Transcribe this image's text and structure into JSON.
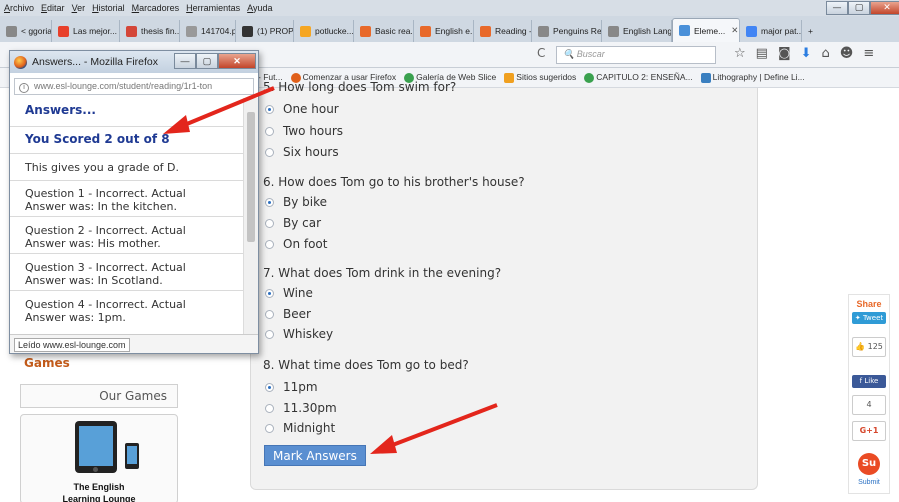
{
  "menubar": {
    "items": [
      "Archivo",
      "Editar",
      "Ver",
      "Historial",
      "Marcadores",
      "Herramientas",
      "Ayuda"
    ]
  },
  "window_controls": {
    "minimize": "—",
    "maximize": "▢",
    "close": "✕"
  },
  "tabs": [
    {
      "label": "< ggoria...",
      "icon_color": "#888888"
    },
    {
      "label": "Las mejor...",
      "icon_color": "#e8402b"
    },
    {
      "label": "thesis fin...",
      "icon_color": "#d44638"
    },
    {
      "label": "141704.pdf",
      "icon_color": "#999999"
    },
    {
      "label": "(1) PROP...",
      "icon_color": "#333333"
    },
    {
      "label": "potlucke...",
      "icon_color": "#f5a623"
    },
    {
      "label": "Basic rea...",
      "icon_color": "#e8692a"
    },
    {
      "label": "English e...",
      "icon_color": "#e8692a"
    },
    {
      "label": "Reading -...",
      "icon_color": "#e8692a"
    },
    {
      "label": "Penguins Rea...",
      "icon_color": "#888888"
    },
    {
      "label": "English Lang...",
      "icon_color": "#888888"
    },
    {
      "label": "Eleme...",
      "icon_color": "#4a90d9",
      "active": true,
      "close": "✕"
    },
    {
      "label": "major pat...",
      "icon_color": "#4285f4"
    }
  ],
  "navbar": {
    "reload": "C",
    "search_placeholder": "Buscar",
    "icons": [
      "star-icon",
      "bookmark-list-icon",
      "pocket-icon",
      "download-icon",
      "home-icon",
      "chat-icon",
      "menu-icon"
    ]
  },
  "bookmarks": [
    "- Fut...",
    "Comenzar a usar Firefox",
    "Galería de Web Slice",
    "Sitios sugeridos",
    "CAPITULO 2: ENSEÑA...",
    "Lithography | Define Li..."
  ],
  "quiz": {
    "cutoff_question": "5. How long does Tom swim for?",
    "q5_options": [
      "One hour",
      "Two hours",
      "Six hours"
    ],
    "q6": "6. How does Tom go to his brother's house?",
    "q6_options": [
      "By bike",
      "By car",
      "On foot"
    ],
    "q7": "7. What does Tom drink in the evening?",
    "q7_options": [
      "Wine",
      "Beer",
      "Whiskey"
    ],
    "q8": "8. What time does Tom go to bed?",
    "q8_options": [
      "11pm",
      "11.30pm",
      "Midnight"
    ],
    "mark_button": "Mark Answers"
  },
  "sidebar": {
    "games_heading": "Games",
    "our_games": "Our Games",
    "card_title_line1": "The English",
    "card_title_line2": "Learning Lounge"
  },
  "share": {
    "title": "Share",
    "tweet": "Tweet",
    "likes_count": "125",
    "fb_like": "Like",
    "plus_count": "4",
    "gplus": "G+1",
    "stumble": "Su",
    "submit": "Submit"
  },
  "popup": {
    "title": "Answers... - Mozilla Firefox",
    "url": "www.esl-lounge.com/student/reading/1r1-ton",
    "heading": "Answers...",
    "score": "You Scored 2 out of 8",
    "grade": "This gives you a grade of D.",
    "answers": [
      {
        "line1": "Question 1 - Incorrect. Actual",
        "line2": "Answer was: In the kitchen."
      },
      {
        "line1": "Question 2 - Incorrect. Actual",
        "line2": "Answer was: His mother."
      },
      {
        "line1": "Question 3 - Incorrect. Actual",
        "line2": "Answer was: In Scotland."
      },
      {
        "line1": "Question 4 - Incorrect. Actual",
        "line2": "Answer was: 1pm."
      }
    ],
    "status": "Leído www.esl-lounge.com"
  },
  "colors": {
    "annotation_arrow": "#e3261c",
    "button": "#5a8fd1",
    "games_heading": "#c35b1a"
  }
}
